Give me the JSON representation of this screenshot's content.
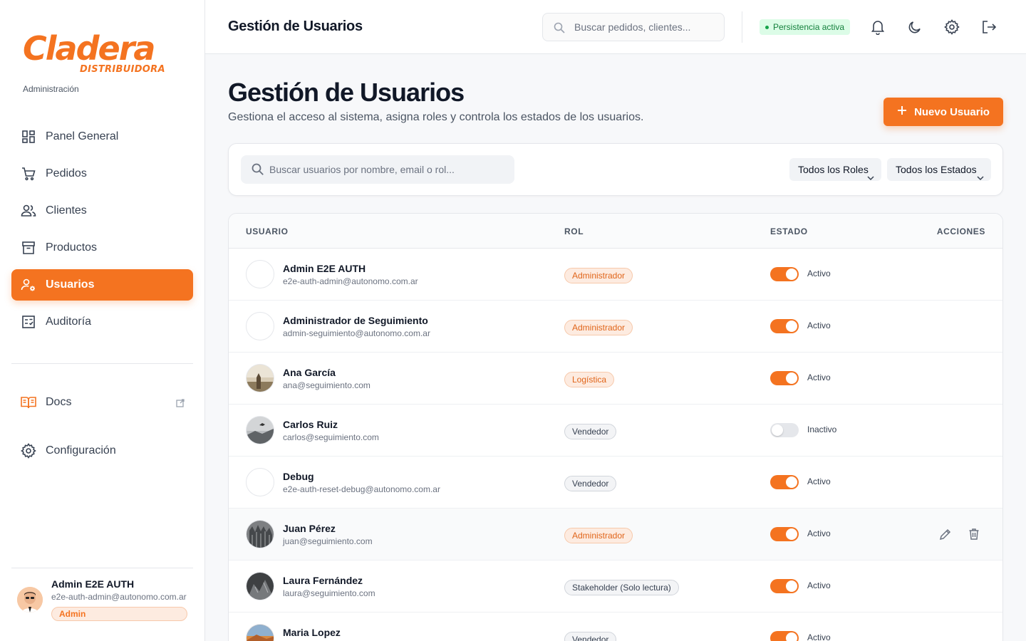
{
  "brand": {
    "name": "Cladera",
    "sub": "DISTRIBUIDORA",
    "section": "Administración",
    "accent": "#f47320"
  },
  "nav": [
    {
      "label": "Panel General",
      "icon": "dashboard-icon"
    },
    {
      "label": "Pedidos",
      "icon": "cart-icon"
    },
    {
      "label": "Clientes",
      "icon": "users-icon"
    },
    {
      "label": "Productos",
      "icon": "archive-icon"
    },
    {
      "label": "Usuarios",
      "icon": "user-gear-icon",
      "active": true
    },
    {
      "label": "Auditoría",
      "icon": "checklist-icon"
    }
  ],
  "nav2": [
    {
      "label": "Docs",
      "icon": "book-icon"
    },
    {
      "label": "Configuración",
      "icon": "gear-icon"
    }
  ],
  "current_user": {
    "name": "Admin E2E AUTH",
    "email": "e2e-auth-admin@autonomo.com.ar",
    "role": "Admin"
  },
  "topbar": {
    "title": "Gestión de Usuarios",
    "search_placeholder": "Buscar pedidos, clientes...",
    "persistence": "Persistencia activa"
  },
  "page": {
    "title": "Gestión de Usuarios",
    "subtitle": "Gestiona el acceso al sistema, asigna roles y controla los estados de los usuarios.",
    "new_button": "Nuevo Usuario"
  },
  "filters": {
    "search_placeholder": "Buscar usuarios por nombre, email o rol...",
    "roles": "Todos los Roles",
    "states": "Todos los Estados"
  },
  "table": {
    "headers": {
      "user": "USUARIO",
      "role": "ROL",
      "state": "ESTADO",
      "actions": "ACCIONES"
    },
    "rows": [
      {
        "name": "Admin E2E AUTH",
        "email": "e2e-auth-admin@autonomo.com.ar",
        "role": "Administrador",
        "role_style": "orange",
        "active": true,
        "status": "Activo",
        "photo": "none"
      },
      {
        "name": "Administrador de Seguimiento",
        "email": "admin-seguimiento@autonomo.com.ar",
        "role": "Administrador",
        "role_style": "orange",
        "active": true,
        "status": "Activo",
        "photo": "none"
      },
      {
        "name": "Ana García",
        "email": "ana@seguimiento.com",
        "role": "Logística",
        "role_style": "orange",
        "active": true,
        "status": "Activo",
        "photo": "beige"
      },
      {
        "name": "Carlos Ruiz",
        "email": "carlos@seguimiento.com",
        "role": "Vendedor",
        "role_style": "gray",
        "active": false,
        "status": "Inactivo",
        "photo": "gray"
      },
      {
        "name": "Debug",
        "email": "e2e-auth-reset-debug@autonomo.com.ar",
        "role": "Vendedor",
        "role_style": "gray",
        "active": true,
        "status": "Activo",
        "photo": "none"
      },
      {
        "name": "Juan Pérez",
        "email": "juan@seguimiento.com",
        "role": "Administrador",
        "role_style": "orange",
        "active": true,
        "status": "Activo",
        "photo": "dark",
        "hover": true
      },
      {
        "name": "Laura Fernández",
        "email": "laura@seguimiento.com",
        "role": "Stakeholder (Solo lectura)",
        "role_style": "gray",
        "active": true,
        "status": "Activo",
        "photo": "darker"
      },
      {
        "name": "Maria Lopez",
        "email": "",
        "role": "Vendedor",
        "role_style": "gray",
        "active": true,
        "status": "Activo",
        "photo": "warm"
      }
    ]
  }
}
